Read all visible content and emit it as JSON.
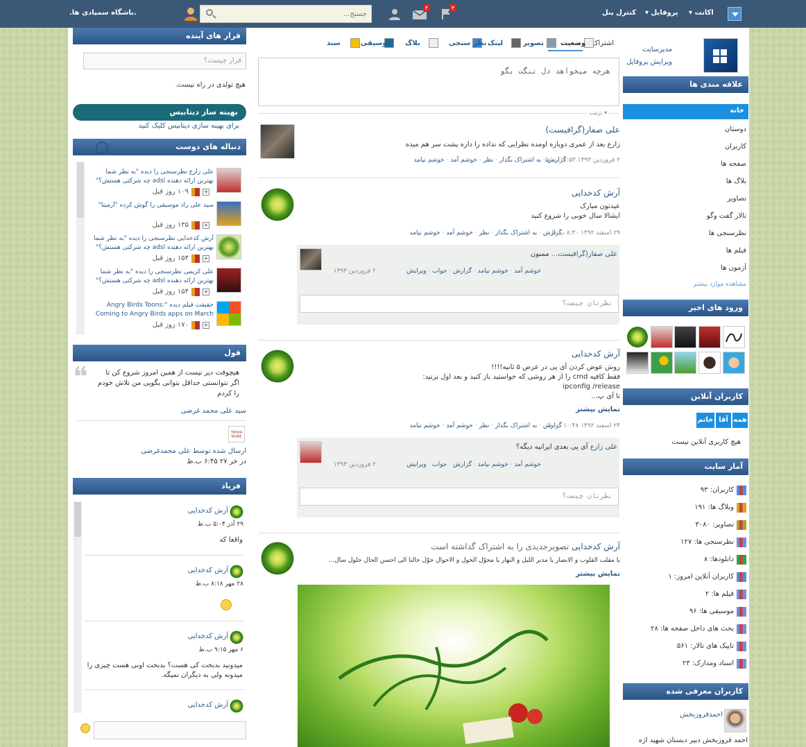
{
  "topbar": {
    "account": "اکانت",
    "profile": "پروفایل",
    "control_panel": "کنترل پنل",
    "search_placeholder": "جستج...",
    "site_name": ".باشگاه سمپادی ها.",
    "badge_notifications": "۴",
    "badge_messages": "۴",
    "badge_requests": ""
  },
  "profile_box": {
    "role": "مدیرسایت",
    "edit": "ویرایش پروفایل"
  },
  "right_sidebar": {
    "interests_title": "علاقه مندی ها",
    "nav_home": "خانه",
    "nav": [
      "دوستان",
      "کاربران",
      "صفحه ها",
      "بلاگ ها",
      "تصاویر",
      "تالار گفت وگو",
      "نظرسنجی ها",
      "فیلم ها",
      "آزمون ها"
    ],
    "show_more": "مشاهده موارد بیشتر",
    "recent_logins_title": "ورود های اخیر",
    "online_title": "کاربران آنلاین",
    "online_tabs": [
      "همه",
      "آقا",
      "خانم"
    ],
    "online_empty": "هیچ کاربری آنلاین نیست",
    "stats_title": "آمار سایت",
    "stats": [
      "کاربران: ۹۳",
      "وبلاگ ها: ۱۹۱",
      "تصاویر: ۳۰۸۰",
      "نظرسنجی ها: ۱۲۷",
      "دانلودها: ۸",
      "کاربران آنلاین امروز: ۱",
      "فیلم ها: ۲",
      "موسیقی ها: ۹۶",
      "بحث های داخل صفحه ها: ۲۸",
      "تاپیک های تالار: ۵۶۱",
      "اسناد ومدارک: ۲۳"
    ],
    "featured_title": "کاربران معرفی شده",
    "featured_name": "احمدفروزبخش",
    "featured_desc": "احمد فروزبخش دبیر دبستان شهید اژه"
  },
  "composer": {
    "share_label": "اشتراک:",
    "tabs": [
      "وضعیت",
      "تصویر",
      "لینک",
      "نظر سنجی",
      "بلاگ",
      "موسیقی",
      "سند"
    ],
    "placeholder": "هرچه میخواهد دل تنگت بگو",
    "sort": "▾ ترتیب"
  },
  "feed": [
    {
      "author": "علی صفار(گرافیست)",
      "text": "زارع بعد از عمری دوباره اومده نظرایی که نداده را داره پشت سر هم میده",
      "meta": "۲ فروردین ۱۳۹۳ ۱۱:۵۳ ب.ظ",
      "actions": [
        "گزارش",
        "به اشتراک بگذار",
        "نظر",
        "خوشم آمد",
        "خوشم نیامد"
      ]
    },
    {
      "author": "آرش کدخدایی",
      "line1": "عیدتون مبارک",
      "line2": "ایشالا سال خوبی را شروع کنید",
      "meta": "۲۹ اسفند ۱۳۹۲ ۸:۳۰ ب.ظ",
      "actions": [
        "گزارش",
        "به اشتراک بگذار",
        "نظر",
        "خوشم آمد",
        "خوشم نیامد"
      ],
      "comment": {
        "author": "علی صفار(گرافیست...",
        "text": "ممنون",
        "actions": [
          "خوشم آمد",
          "خوشم نیامد",
          "گزارش",
          "جواب",
          "ویرایش"
        ],
        "date": "۲ فروردین ۱۳۹۳"
      },
      "comment_placeholder": "نظرتان چیست؟"
    },
    {
      "author": "آرش کدخدایی",
      "line1": "روش عوض کردن آی پی در عرض ۵ ثانیه!!!!",
      "line2": "فقط کافیه cmd را از هر روشی که خواستید باز کنید و بعد اول بزنید:",
      "line3": "ipconfig /release",
      "line4": "تا آی پ...",
      "more": "نمایش بیشتر",
      "meta": "۲۴ اسفند ۱۳۹۲ ۱۰:۴۸ ب.ظ",
      "actions": [
        "گزارش",
        "به اشتراک بگذار",
        "نظر",
        "خوشم آمد",
        "خوشم نیامد"
      ],
      "comment": {
        "author": "علی زارع",
        "text": "آی پی بعدی ایرانیه دیگه؟",
        "actions": [
          "خوشم آمد",
          "خوشم نیامد",
          "گزارش",
          "جواب",
          "ویرایش"
        ],
        "date": "۲ فروردین ۱۳۹۳"
      },
      "comment_placeholder": "نظرتان چیست؟"
    },
    {
      "author": "آرش کدخدایی",
      "headline": "تصویرجدیدی را به اشتراک گذاشته است",
      "text": "یا مقلب القلوب و الابصار یا مدبر اللیل و النهار یا محوّل الحول و الاحوال حوّل حالنا الی احسن الحال حلول سال...",
      "more": "نمایش بیشتر"
    }
  ],
  "left_sidebar": {
    "events_title": "قرار های آینده",
    "events_placeholder": "قرار چیست؟",
    "no_birthdays": "هیچ تولدی در راه نیست.",
    "db_title": "بهینه ساز دیتابیس",
    "db_desc": "برای بهینه سازی دیتابیس کلیک کنید",
    "friends_title": "دنباله های دوست",
    "friends": [
      {
        "text": "علی زارع نظرسنجی را دیده \"به نظر شما بهترین ارائه دهنده adsl چه شرکتی هستش؟\"",
        "time": "۱۰۹ روز قبل"
      },
      {
        "text": "سید علی راد موسیقی را گوش کرده \"آرمیتا\"",
        "time": "۱۳۵ روز قبل"
      },
      {
        "text": "آرش کدخدایی نظرسنجی را دیده \"به نظر شما بهترین ارائه دهنده adsl چه شرکتی هستش؟\"",
        "time": "۱۵۴ روز قبل"
      },
      {
        "text": "علی کریمی نظرسنجی را دیده \"به نظر شما بهترین ارائه دهنده adsl چه شرکتی هستش؟\"",
        "time": "۱۵۴ روز قبل"
      },
      {
        "text": "حقیقت فیلم دیده \":Angry Birds Toons Coming to Angry Birds apps on March ۱۷\"",
        "time": "۱۷۰ روز قبل"
      }
    ],
    "quote_title": "قول",
    "quote_text": "هیچوقت دیر نیست از همین امروز شروع کن تا اگر نتوانستی حداقل بتوانی بگویی من تلاش خودم را کردم",
    "quote_author": "سید علی محمد غرضی",
    "quote_sent": "ارسال شده توسط علی محمدغرضی",
    "quote_date": "در خر ۲۷ ۶:۴۵ ب.ظ",
    "shout_title": "فریاد",
    "shouts": [
      {
        "author": "آرش کدخدایی",
        "date": "۲۹ آذر ۵:۰۴ ب.ظ",
        "text": "واقعا که"
      },
      {
        "author": "آرش کدخدایی",
        "date": "۲۸ مهر ۸:۱۸ ب.ظ",
        "text": ""
      },
      {
        "author": "آرش کدخدایی",
        "date": "۶ مهر ۹:۱۵ ب.ظ",
        "text": "میدونید بدبخت کی هست؟ بدبخت اونی هست چیزی را میدونه ولی به دیگران نمیگه."
      },
      {
        "author": "آرش کدخدایی",
        "date": "",
        "text": ""
      }
    ]
  }
}
